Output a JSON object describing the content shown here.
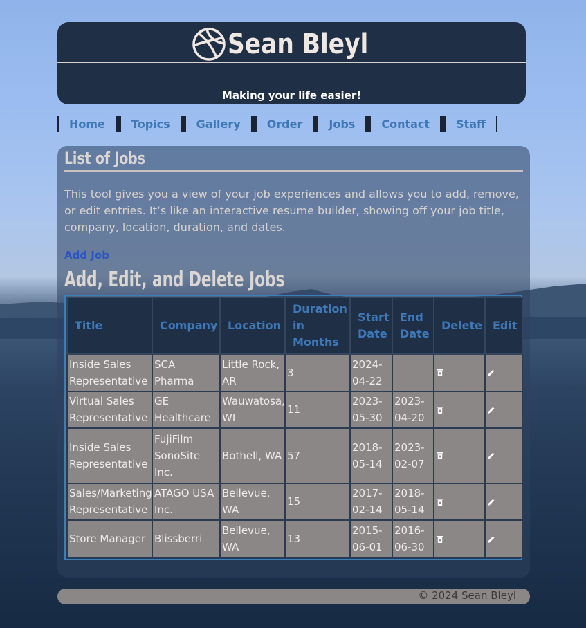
{
  "header": {
    "logo_icon": "basketball-icon",
    "brand": "Sean Bleyl",
    "tagline": "Making your life easier!"
  },
  "nav": {
    "items": [
      "Home",
      "Topics",
      "Gallery",
      "Order",
      "Jobs",
      "Contact",
      "Staff"
    ]
  },
  "main": {
    "title": "List of Jobs",
    "intro": "This tool gives you a view of your job experiences and allows you to add, remove, or edit entries. It’s like an interactive resume builder, showing off your job title, company, location, duration, and dates.",
    "add_link": "Add Job",
    "subtitle": "Add, Edit, and Delete Jobs"
  },
  "table": {
    "headers": {
      "title": "Title",
      "company": "Company",
      "location": "Location",
      "duration": "Duration in Months",
      "start": "Start Date",
      "end": "End Date",
      "delete": "Delete",
      "edit": "Edit"
    },
    "rows": [
      {
        "title": "Inside Sales Representative",
        "company": "SCA Pharma",
        "location": "Little Rock, AR",
        "duration": "3",
        "start": "2024-04-22",
        "end": ""
      },
      {
        "title": "Virtual Sales Representative",
        "company": "GE Healthcare",
        "location": "Wauwatosa, WI",
        "duration": "11",
        "start": "2023-05-30",
        "end": "2023-04-20"
      },
      {
        "title": "Inside Sales Representative",
        "company": "FujiFilm SonoSite Inc.",
        "location": "Bothell, WA",
        "duration": "57",
        "start": "2018-05-14",
        "end": "2023-02-07"
      },
      {
        "title": "Sales/Marketing Representative",
        "company": "ATAGO USA Inc.",
        "location": "Bellevue, WA",
        "duration": "15",
        "start": "2017-02-14",
        "end": "2018-05-14"
      },
      {
        "title": "Store Manager",
        "company": "Blissberri",
        "location": "Bellevue, WA",
        "duration": "13",
        "start": "2015-06-01",
        "end": "2016-06-30"
      }
    ],
    "delete_icon": "trash-icon",
    "edit_icon": "pencil-icon"
  },
  "footer": {
    "copyright": "© 2024 Sean Bleyl"
  },
  "colors": {
    "header_bg": "#1f2f46",
    "nav_link": "#3e78b6",
    "add_link": "#2b55c6",
    "cell_bg": "#8c8787",
    "table_border": "#3a7fb8"
  }
}
